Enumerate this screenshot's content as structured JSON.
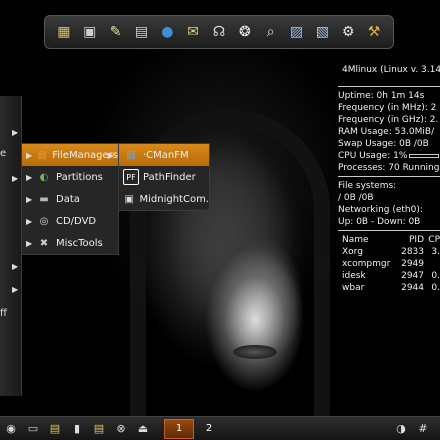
{
  "dock": {
    "icons": [
      {
        "name": "disk-icon",
        "glyph": "▦",
        "color": "#e0c060"
      },
      {
        "name": "terminal-icon",
        "glyph": "▣",
        "color": "#cfcfcf"
      },
      {
        "name": "editor-icon",
        "glyph": "✎",
        "color": "#e8d8a0"
      },
      {
        "name": "calculator-icon",
        "glyph": "▤",
        "color": "#d0d0d0"
      },
      {
        "name": "globe-icon",
        "glyph": "●",
        "color": "#3f8fd8"
      },
      {
        "name": "mail-icon",
        "glyph": "✉",
        "color": "#f0d070"
      },
      {
        "name": "headphones-icon",
        "glyph": "☊",
        "color": "#dddddd"
      },
      {
        "name": "film-reel-icon",
        "glyph": "❂",
        "color": "#eeeeee"
      },
      {
        "name": "magnifier-icon",
        "glyph": "⌕",
        "color": "#e0e0e0"
      },
      {
        "name": "network-icon",
        "glyph": "▨",
        "color": "#9fbfe0"
      },
      {
        "name": "package-icon",
        "glyph": "▧",
        "color": "#b0c8e0"
      },
      {
        "name": "settings-icon",
        "glyph": "⚙",
        "color": "#e8e8e8"
      },
      {
        "name": "tools-icon",
        "glyph": "⚒",
        "color": "#e0b040"
      }
    ]
  },
  "conky": {
    "title": "4Mlinux (Linux v. 3.14.",
    "uptime": "Uptime: 0h 1m 14s",
    "freq_mhz": "Frequency (in MHz): 2",
    "freq_ghz": "Frequency (in GHz): 2.",
    "ram": "RAM Usage: 53.0MiB/",
    "swap": "Swap Usage: 0B /0B",
    "cpu": "CPU Usage: 1%",
    "processes": "Processes: 70  Running",
    "fs_label": "File systems:",
    "fs_value": " / 0B /0B",
    "net_label": "Networking (eth0):",
    "net_value": "Up: 0B    - Down: 0B",
    "proc_header": {
      "name": "Name",
      "pid": "PID",
      "cpu": "CP"
    },
    "procs": [
      {
        "name": "Xorg",
        "pid": "2833",
        "cpu": "3."
      },
      {
        "name": "xcompmgr",
        "pid": "2949",
        "cpu": ""
      },
      {
        "name": "idesk",
        "pid": "2947",
        "cpu": "0."
      },
      {
        "name": "wbar",
        "pid": "2944",
        "cpu": "0."
      }
    ]
  },
  "left_panel": {
    "fragments": [
      "e",
      "ff"
    ]
  },
  "menu1": {
    "items": [
      {
        "label": "FileManagers",
        "icon": "folder-icon",
        "glyph": "▤",
        "color": "#e0a030",
        "active": true
      },
      {
        "label": "Partitions",
        "icon": "partitions-icon",
        "glyph": "◐",
        "color": "#7ab848",
        "active": false
      },
      {
        "label": "Data",
        "icon": "data-icon",
        "glyph": "▬",
        "color": "#bbbbbb",
        "active": false
      },
      {
        "label": "CD/DVD",
        "icon": "cd-icon",
        "glyph": "◎",
        "color": "#dddddd",
        "active": false
      },
      {
        "label": "MiscTools",
        "icon": "misctools-icon",
        "glyph": "✖",
        "color": "#cccccc",
        "active": false
      }
    ]
  },
  "menu2": {
    "items": [
      {
        "label": "·CManFM",
        "icon": "pcmanfm-icon",
        "glyph": "▤",
        "color": "#6fa8e0",
        "active": true
      },
      {
        "label": "PathFinder",
        "icon": "pathfinder-icon",
        "glyph": "PF",
        "color": "#ffffff",
        "active": false
      },
      {
        "label": "MidnightCom.",
        "icon": "midnight-commander-icon",
        "glyph": "▣",
        "color": "#dddddd",
        "active": false
      }
    ]
  },
  "taskbar": {
    "left_icons": [
      {
        "name": "start-icon",
        "glyph": "◉",
        "color": "#dddddd"
      },
      {
        "name": "keyboard-icon",
        "glyph": "▭",
        "color": "#cccccc"
      },
      {
        "name": "home-folder-icon",
        "glyph": "▤",
        "color": "#e0c060"
      },
      {
        "name": "battery-icon",
        "glyph": "▮",
        "color": "#dddddd"
      },
      {
        "name": "document-icon",
        "glyph": "▤",
        "color": "#e0c060"
      },
      {
        "name": "close-circle-icon",
        "glyph": "⊗",
        "color": "#dddddd"
      },
      {
        "name": "eject-icon",
        "glyph": "⏏",
        "color": "#dddddd"
      }
    ],
    "workspaces": [
      {
        "label": "1",
        "active": true
      },
      {
        "label": "2",
        "active": false
      }
    ],
    "right_icons": [
      {
        "name": "volume-icon",
        "glyph": "◑",
        "color": "#dddddd"
      },
      {
        "name": "grid-icon",
        "glyph": "#",
        "color": "#dddddd"
      }
    ]
  }
}
